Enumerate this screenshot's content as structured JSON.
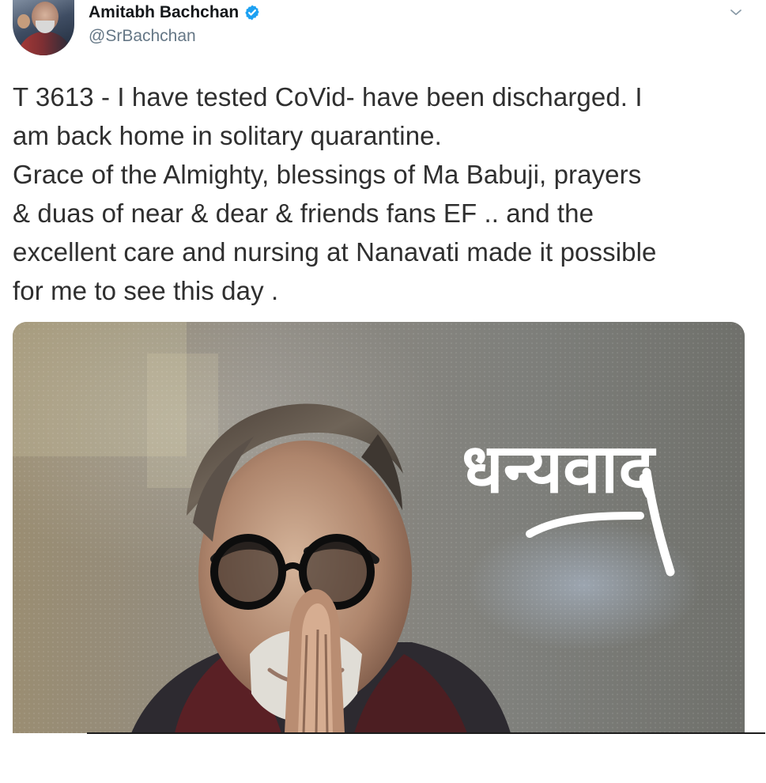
{
  "tweet": {
    "author": {
      "display_name": "Amitabh Bachchan",
      "handle": "@SrBachchan",
      "verified_icon": "verified-badge-icon",
      "avatar_icon": "profile-avatar"
    },
    "menu_icon": "chevron-down-icon",
    "text": "T 3613 - I have tested CoVid- have been discharged. I\nam back home in solitary quarantine.\nGrace of the Almighty, blessings of Ma Babuji, prayers\n& duas of near & dear & friends fans EF .. and the\nexcellent care and nursing at Nanavati made it possible\nfor me to see this day .",
    "media": {
      "image_text": "धन्यवाद",
      "kind": "photo"
    }
  },
  "colors": {
    "name": "#14171a",
    "handle": "#657786",
    "text": "#2f2f2f",
    "verified": "#1da1f2"
  }
}
